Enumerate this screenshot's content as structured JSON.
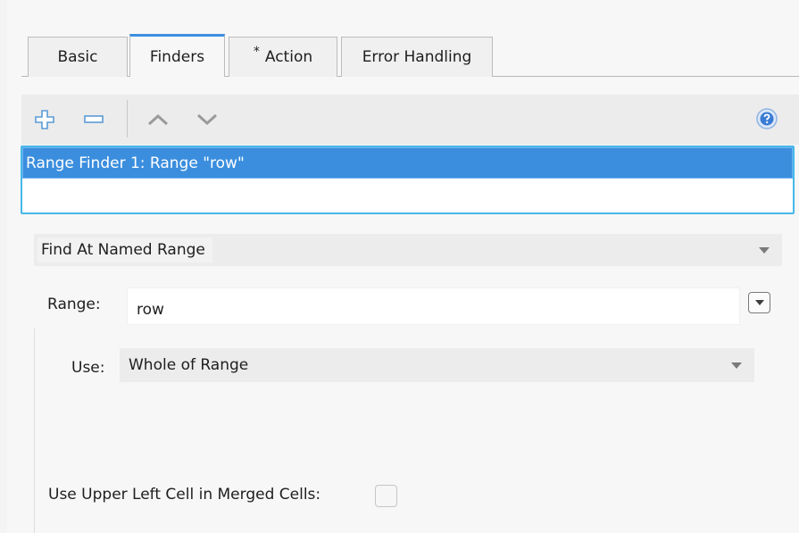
{
  "tabs": [
    {
      "label": "Basic",
      "active": false,
      "modified": false
    },
    {
      "label": "Finders",
      "active": true,
      "modified": false
    },
    {
      "label": "Action",
      "active": false,
      "modified": true,
      "modified_marker": "*"
    },
    {
      "label": "Error Handling",
      "active": false,
      "modified": false
    }
  ],
  "toolbar": {
    "icons": [
      "add-icon",
      "remove-icon",
      "move-up-icon",
      "move-down-icon",
      "help-icon"
    ]
  },
  "finder_list": {
    "items": [
      {
        "label": "Range Finder 1: Range \"row\"",
        "selected": true
      }
    ]
  },
  "finder_type": {
    "selected": "Find At Named Range"
  },
  "range": {
    "label": "Range:",
    "value": "row"
  },
  "use": {
    "label": "Use:",
    "selected": "Whole of Range"
  },
  "merged_cells": {
    "label": "Use Upper Left Cell in Merged Cells:",
    "checked": false
  },
  "colors": {
    "accent": "#3b8ede",
    "list_border": "#45b8e8",
    "icon_blue": "#5b9bd5",
    "help_blue": "#3a7bd5"
  }
}
